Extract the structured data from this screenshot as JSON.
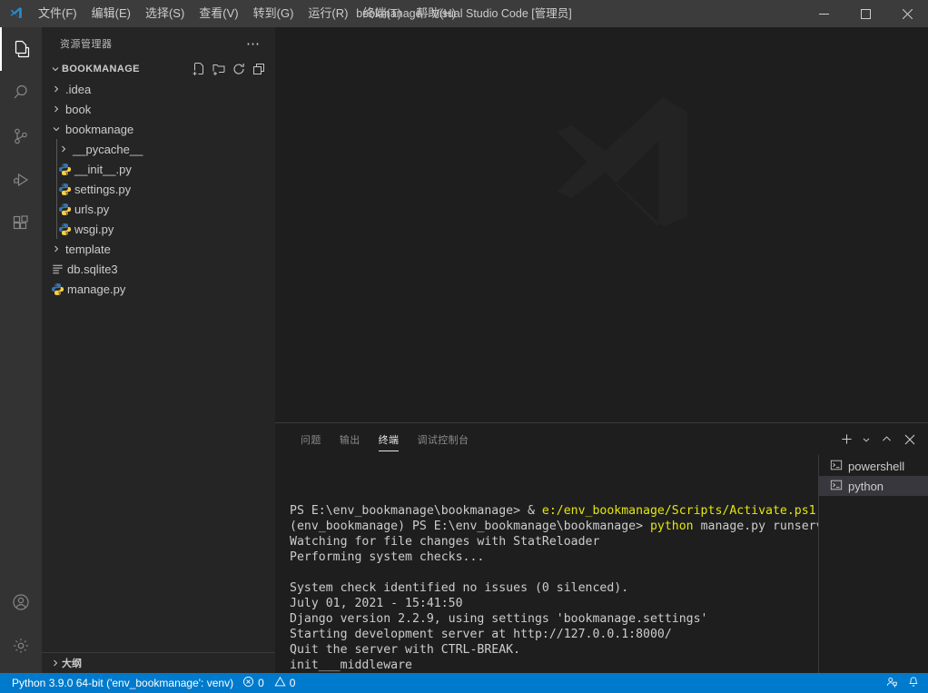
{
  "titlebar": {
    "logo_icon": "vscode-logo-icon",
    "menus": [
      {
        "label": "文件(F)",
        "name": "menu-file"
      },
      {
        "label": "编辑(E)",
        "name": "menu-edit"
      },
      {
        "label": "选择(S)",
        "name": "menu-selection"
      },
      {
        "label": "查看(V)",
        "name": "menu-view"
      },
      {
        "label": "转到(G)",
        "name": "menu-go"
      },
      {
        "label": "运行(R)",
        "name": "menu-run"
      },
      {
        "label": "终端(T)",
        "name": "menu-terminal"
      },
      {
        "label": "帮助(H)",
        "name": "menu-help"
      }
    ],
    "window_title": "bookmanage - Visual Studio Code [管理员]",
    "minimize_icon": "minimize-icon",
    "maximize_icon": "maximize-icon",
    "close_icon": "close-icon"
  },
  "activitybar": {
    "items": [
      {
        "name": "activity-explorer",
        "icon": "files-icon",
        "active": true
      },
      {
        "name": "activity-search",
        "icon": "search-icon",
        "active": false
      },
      {
        "name": "activity-source-control",
        "icon": "source-control-icon",
        "active": false
      },
      {
        "name": "activity-run-debug",
        "icon": "run-debug-icon",
        "active": false
      },
      {
        "name": "activity-extensions",
        "icon": "extensions-icon",
        "active": false
      }
    ],
    "bottom": [
      {
        "name": "activity-account",
        "icon": "account-icon"
      },
      {
        "name": "activity-settings",
        "icon": "gear-icon"
      }
    ]
  },
  "sidebar": {
    "title": "资源管理器",
    "more_actions_icon": "ellipsis-icon",
    "project": {
      "name": "BOOKMANAGE",
      "expanded": true,
      "actions": [
        {
          "name": "new-file-button",
          "icon": "new-file-icon"
        },
        {
          "name": "new-folder-button",
          "icon": "new-folder-icon"
        },
        {
          "name": "refresh-explorer-button",
          "icon": "refresh-icon"
        },
        {
          "name": "collapse-all-button",
          "icon": "collapse-all-icon"
        }
      ]
    },
    "tree": [
      {
        "label": ".idea",
        "type": "folder",
        "depth": 0,
        "expanded": false
      },
      {
        "label": "book",
        "type": "folder",
        "depth": 0,
        "expanded": false
      },
      {
        "label": "bookmanage",
        "type": "folder",
        "depth": 0,
        "expanded": true
      },
      {
        "label": "__pycache__",
        "type": "folder",
        "depth": 1,
        "expanded": false
      },
      {
        "label": "__init__.py",
        "type": "python",
        "depth": 1
      },
      {
        "label": "settings.py",
        "type": "python",
        "depth": 1
      },
      {
        "label": "urls.py",
        "type": "python",
        "depth": 1
      },
      {
        "label": "wsgi.py",
        "type": "python",
        "depth": 1
      },
      {
        "label": "template",
        "type": "folder",
        "depth": 0,
        "expanded": false
      },
      {
        "label": "db.sqlite3",
        "type": "database",
        "depth": 0
      },
      {
        "label": "manage.py",
        "type": "python",
        "depth": 0
      }
    ],
    "outline": {
      "label": "大纲",
      "expanded": false
    }
  },
  "editor": {
    "watermark_icon": "vscode-logo-watermark"
  },
  "panel": {
    "tabs": [
      {
        "label": "问题",
        "name": "tab-problems",
        "active": false
      },
      {
        "label": "输出",
        "name": "tab-output",
        "active": false
      },
      {
        "label": "终端",
        "name": "tab-terminal",
        "active": true
      },
      {
        "label": "调试控制台",
        "name": "tab-debug-console",
        "active": false
      }
    ],
    "actions": [
      {
        "name": "new-terminal-button",
        "icon": "plus-icon"
      },
      {
        "name": "terminal-kind-dropdown",
        "icon": "chevron-down-icon"
      },
      {
        "name": "maximize-panel-button",
        "icon": "chevron-up-icon"
      },
      {
        "name": "close-panel-button",
        "icon": "close-icon"
      }
    ],
    "terminal_tabs": [
      {
        "label": "powershell",
        "icon": "terminal-icon",
        "active": false
      },
      {
        "label": "python",
        "icon": "terminal-icon",
        "active": true
      }
    ],
    "terminal_lines": [
      [
        {
          "t": "PS E:\\env_bookmanage\\bookmanage> & ",
          "c": "normal"
        },
        {
          "t": "e:/env_bookmanage/Scripts/Activate.ps1",
          "c": "yellow"
        }
      ],
      [
        {
          "t": "(env_bookmanage) PS E:\\env_bookmanage\\bookmanage> ",
          "c": "normal"
        },
        {
          "t": "python",
          "c": "yellow"
        },
        {
          "t": " manage.py runserver",
          "c": "normal"
        }
      ],
      [
        {
          "t": "Watching for file changes with StatReloader",
          "c": "normal"
        }
      ],
      [
        {
          "t": "Performing system checks...",
          "c": "normal"
        }
      ],
      [
        {
          "t": "",
          "c": "normal"
        }
      ],
      [
        {
          "t": "System check identified no issues (0 silenced).",
          "c": "normal"
        }
      ],
      [
        {
          "t": "July 01, 2021 - 15:41:50",
          "c": "normal"
        }
      ],
      [
        {
          "t": "Django version 2.2.9, using settings 'bookmanage.settings'",
          "c": "normal"
        }
      ],
      [
        {
          "t": "Starting development server at http://127.0.0.1:8000/",
          "c": "normal"
        }
      ],
      [
        {
          "t": "Quit the server with CTRL-BREAK.",
          "c": "normal"
        }
      ],
      [
        {
          "t": "init___middleware",
          "c": "normal"
        }
      ]
    ]
  },
  "statusbar": {
    "python_interpreter": "Python 3.9.0 64-bit ('env_bookmanage': venv)",
    "error_icon": "error-icon",
    "error_count": "0",
    "warning_icon": "warning-icon",
    "warning_count": "0",
    "feedback_icon": "feedback-icon",
    "bell_icon": "bell-icon"
  },
  "colors": {
    "accent": "#007acc",
    "titlebar_bg": "#3c3c3c",
    "activitybar_bg": "#333333",
    "sidebar_bg": "#252526",
    "editor_bg": "#1e1e1e",
    "terminal_yellow": "#e5e510",
    "python_icon_blue": "#3776ab"
  }
}
